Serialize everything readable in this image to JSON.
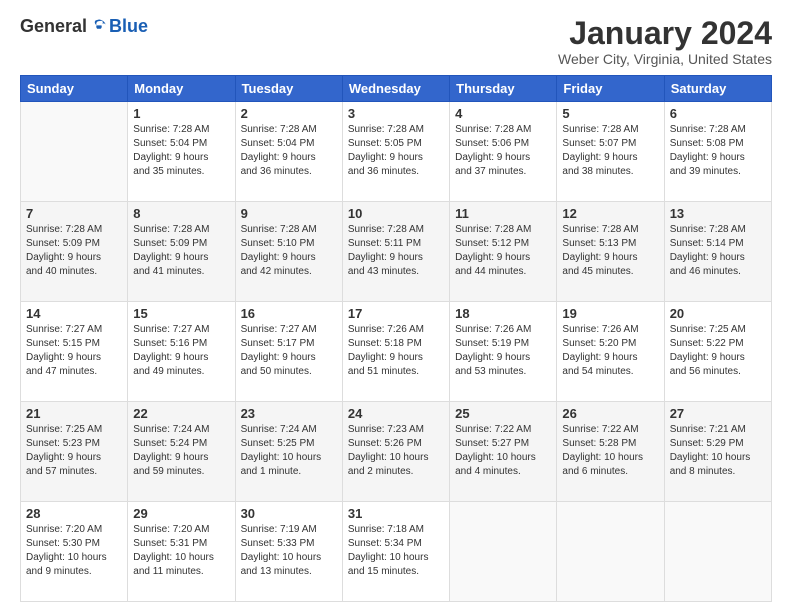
{
  "header": {
    "logo_general": "General",
    "logo_blue": "Blue",
    "month_title": "January 2024",
    "location": "Weber City, Virginia, United States"
  },
  "weekdays": [
    "Sunday",
    "Monday",
    "Tuesday",
    "Wednesday",
    "Thursday",
    "Friday",
    "Saturday"
  ],
  "weeks": [
    [
      {
        "day": "",
        "info": ""
      },
      {
        "day": "1",
        "info": "Sunrise: 7:28 AM\nSunset: 5:04 PM\nDaylight: 9 hours\nand 35 minutes."
      },
      {
        "day": "2",
        "info": "Sunrise: 7:28 AM\nSunset: 5:04 PM\nDaylight: 9 hours\nand 36 minutes."
      },
      {
        "day": "3",
        "info": "Sunrise: 7:28 AM\nSunset: 5:05 PM\nDaylight: 9 hours\nand 36 minutes."
      },
      {
        "day": "4",
        "info": "Sunrise: 7:28 AM\nSunset: 5:06 PM\nDaylight: 9 hours\nand 37 minutes."
      },
      {
        "day": "5",
        "info": "Sunrise: 7:28 AM\nSunset: 5:07 PM\nDaylight: 9 hours\nand 38 minutes."
      },
      {
        "day": "6",
        "info": "Sunrise: 7:28 AM\nSunset: 5:08 PM\nDaylight: 9 hours\nand 39 minutes."
      }
    ],
    [
      {
        "day": "7",
        "info": "Sunrise: 7:28 AM\nSunset: 5:09 PM\nDaylight: 9 hours\nand 40 minutes."
      },
      {
        "day": "8",
        "info": "Sunrise: 7:28 AM\nSunset: 5:09 PM\nDaylight: 9 hours\nand 41 minutes."
      },
      {
        "day": "9",
        "info": "Sunrise: 7:28 AM\nSunset: 5:10 PM\nDaylight: 9 hours\nand 42 minutes."
      },
      {
        "day": "10",
        "info": "Sunrise: 7:28 AM\nSunset: 5:11 PM\nDaylight: 9 hours\nand 43 minutes."
      },
      {
        "day": "11",
        "info": "Sunrise: 7:28 AM\nSunset: 5:12 PM\nDaylight: 9 hours\nand 44 minutes."
      },
      {
        "day": "12",
        "info": "Sunrise: 7:28 AM\nSunset: 5:13 PM\nDaylight: 9 hours\nand 45 minutes."
      },
      {
        "day": "13",
        "info": "Sunrise: 7:28 AM\nSunset: 5:14 PM\nDaylight: 9 hours\nand 46 minutes."
      }
    ],
    [
      {
        "day": "14",
        "info": "Sunrise: 7:27 AM\nSunset: 5:15 PM\nDaylight: 9 hours\nand 47 minutes."
      },
      {
        "day": "15",
        "info": "Sunrise: 7:27 AM\nSunset: 5:16 PM\nDaylight: 9 hours\nand 49 minutes."
      },
      {
        "day": "16",
        "info": "Sunrise: 7:27 AM\nSunset: 5:17 PM\nDaylight: 9 hours\nand 50 minutes."
      },
      {
        "day": "17",
        "info": "Sunrise: 7:26 AM\nSunset: 5:18 PM\nDaylight: 9 hours\nand 51 minutes."
      },
      {
        "day": "18",
        "info": "Sunrise: 7:26 AM\nSunset: 5:19 PM\nDaylight: 9 hours\nand 53 minutes."
      },
      {
        "day": "19",
        "info": "Sunrise: 7:26 AM\nSunset: 5:20 PM\nDaylight: 9 hours\nand 54 minutes."
      },
      {
        "day": "20",
        "info": "Sunrise: 7:25 AM\nSunset: 5:22 PM\nDaylight: 9 hours\nand 56 minutes."
      }
    ],
    [
      {
        "day": "21",
        "info": "Sunrise: 7:25 AM\nSunset: 5:23 PM\nDaylight: 9 hours\nand 57 minutes."
      },
      {
        "day": "22",
        "info": "Sunrise: 7:24 AM\nSunset: 5:24 PM\nDaylight: 9 hours\nand 59 minutes."
      },
      {
        "day": "23",
        "info": "Sunrise: 7:24 AM\nSunset: 5:25 PM\nDaylight: 10 hours\nand 1 minute."
      },
      {
        "day": "24",
        "info": "Sunrise: 7:23 AM\nSunset: 5:26 PM\nDaylight: 10 hours\nand 2 minutes."
      },
      {
        "day": "25",
        "info": "Sunrise: 7:22 AM\nSunset: 5:27 PM\nDaylight: 10 hours\nand 4 minutes."
      },
      {
        "day": "26",
        "info": "Sunrise: 7:22 AM\nSunset: 5:28 PM\nDaylight: 10 hours\nand 6 minutes."
      },
      {
        "day": "27",
        "info": "Sunrise: 7:21 AM\nSunset: 5:29 PM\nDaylight: 10 hours\nand 8 minutes."
      }
    ],
    [
      {
        "day": "28",
        "info": "Sunrise: 7:20 AM\nSunset: 5:30 PM\nDaylight: 10 hours\nand 9 minutes."
      },
      {
        "day": "29",
        "info": "Sunrise: 7:20 AM\nSunset: 5:31 PM\nDaylight: 10 hours\nand 11 minutes."
      },
      {
        "day": "30",
        "info": "Sunrise: 7:19 AM\nSunset: 5:33 PM\nDaylight: 10 hours\nand 13 minutes."
      },
      {
        "day": "31",
        "info": "Sunrise: 7:18 AM\nSunset: 5:34 PM\nDaylight: 10 hours\nand 15 minutes."
      },
      {
        "day": "",
        "info": ""
      },
      {
        "day": "",
        "info": ""
      },
      {
        "day": "",
        "info": ""
      }
    ]
  ]
}
